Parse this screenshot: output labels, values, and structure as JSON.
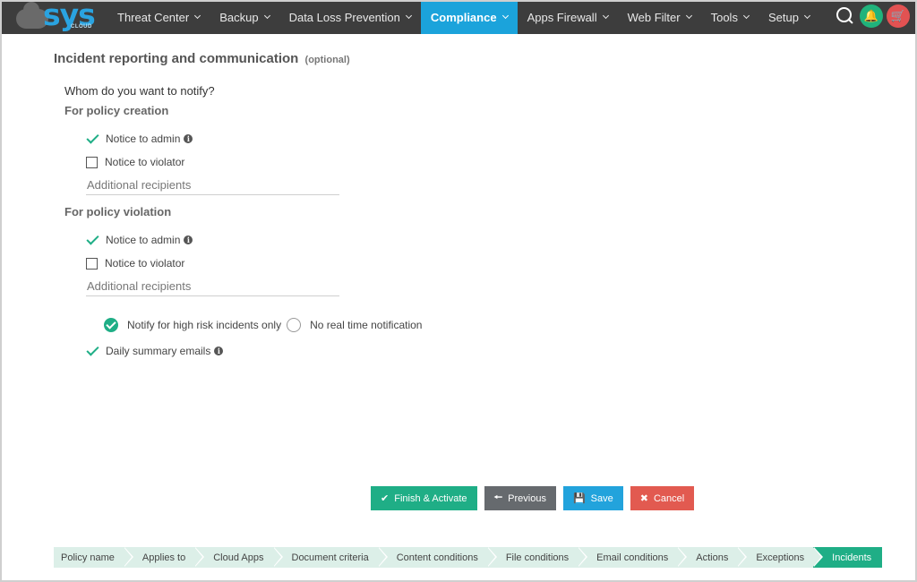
{
  "brand": {
    "logo_text": "sys",
    "logo_sub": "CLOUD",
    "accent": "#1ba3db",
    "green": "#1fae86"
  },
  "nav": {
    "items": [
      {
        "label": "Threat Center"
      },
      {
        "label": "Backup"
      },
      {
        "label": "Data Loss Prevention"
      },
      {
        "label": "Compliance",
        "active": true
      },
      {
        "label": "Apps Firewall"
      },
      {
        "label": "Web Filter"
      },
      {
        "label": "Tools"
      },
      {
        "label": "Setup"
      }
    ],
    "icons": [
      "search-icon",
      "bell-icon",
      "cart-icon"
    ]
  },
  "section": {
    "title": "Incident reporting and communication",
    "optional": "(optional)"
  },
  "question": "Whom do you want to notify?",
  "policy_creation": {
    "heading": "For policy creation",
    "notice_admin": {
      "label": "Notice to admin",
      "checked": true
    },
    "notice_violator": {
      "label": "Notice to violator",
      "checked": false
    },
    "recipients_placeholder": "Additional recipients"
  },
  "policy_violation": {
    "heading": "For policy violation",
    "notice_admin": {
      "label": "Notice to admin",
      "checked": true
    },
    "notice_violator": {
      "label": "Notice to violator",
      "checked": false
    },
    "recipients_placeholder": "Additional recipients"
  },
  "notification_mode": {
    "high_risk": {
      "label": "Notify for high risk incidents only",
      "selected": true
    },
    "no_realtime": {
      "label": "No real time notification",
      "selected": false
    }
  },
  "daily_summary": {
    "label": "Daily summary emails",
    "checked": true
  },
  "buttons": {
    "finish": "Finish & Activate",
    "previous": "Previous",
    "save": "Save",
    "cancel": "Cancel"
  },
  "wizard": {
    "steps": [
      "Policy name",
      "Applies to",
      "Cloud Apps",
      "Document criteria",
      "Content conditions",
      "File conditions",
      "Email conditions",
      "Actions",
      "Exceptions",
      "Incidents"
    ],
    "active_step": "Incidents"
  }
}
